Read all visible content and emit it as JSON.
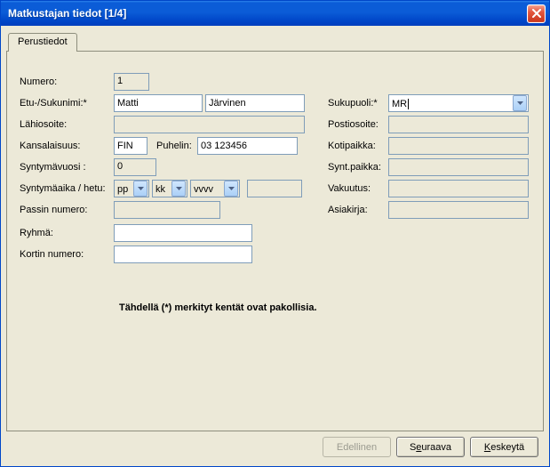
{
  "window": {
    "title": "Matkustajan tiedot [1/4]"
  },
  "tabs": {
    "basic": "Perustiedot"
  },
  "labels": {
    "number": "Numero:",
    "name": "Etu-/Sukunimi:*",
    "localaddr": "Lähiosoite:",
    "nationality": "Kansalaisuus:",
    "phone": "Puhelin:",
    "birthyear": "Syntymävuosi :",
    "dob_ssn": "Syntymäaika / hetu:",
    "passport": "Passin numero:",
    "group": "Ryhmä:",
    "card": "Kortin numero:",
    "gender": "Sukupuoli:*",
    "postaddr": "Postiosoite:",
    "homecity": "Kotipaikka:",
    "birthplace": "Synt.paikka:",
    "insurance": "Vakuutus:",
    "document": "Asiakirja:"
  },
  "values": {
    "number": "1",
    "first_name": "Matti",
    "last_name": "Järvinen",
    "localaddr": "",
    "nationality": "FIN",
    "phone": "03 123456",
    "birthyear": "0",
    "dob_day": "pp",
    "dob_month": "kk",
    "dob_year": "vvvv",
    "ssn": "",
    "passport": "",
    "group": "",
    "card": "",
    "gender": "MR",
    "postaddr": "",
    "homecity": "",
    "birthplace": "",
    "insurance": "",
    "document": ""
  },
  "note": "Tähdellä (*) merkityt kentät ovat pakollisia.",
  "buttons": {
    "prev": "Edellinen",
    "next_pre": "S",
    "next_u": "e",
    "next_post": "uraava",
    "cancel_u": "K",
    "cancel_post": "eskeytä"
  }
}
